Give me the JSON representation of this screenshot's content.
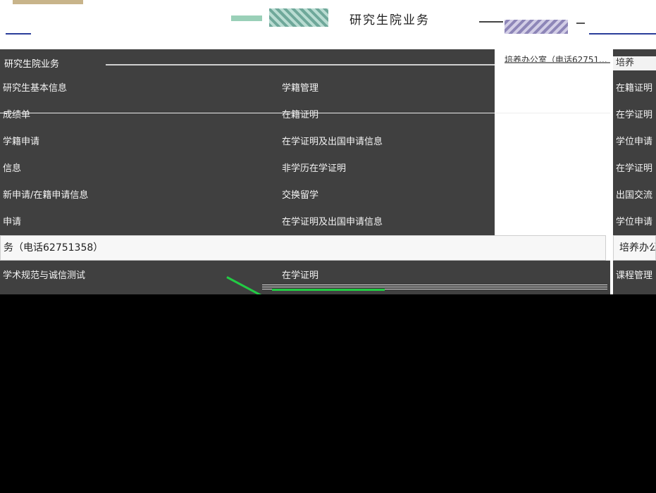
{
  "header": {
    "title": "研究生院业务"
  },
  "left_panel": {
    "heading": "研究生院业务",
    "rows": [
      {
        "col1": "研究生基本信息",
        "col2": "学籍管理"
      },
      {
        "col1": "成绩单",
        "col2": "在籍证明"
      },
      {
        "col1": "学籍申请",
        "col2": "在学证明及出国申请信息"
      },
      {
        "col1": "信息",
        "col2": "非学历在学证明"
      },
      {
        "col1": "新申请/在籍申请信息",
        "col2": "交换留学"
      },
      {
        "col1": "申请",
        "col2": "在学证明及出国申请信息"
      }
    ],
    "band_label": "务（电话62751358）",
    "band_row": {
      "col1": "学术规范与诚信测试",
      "col2": "在学证明"
    }
  },
  "mid_panel": {
    "heading": "培养办公室（电话62751..."
  },
  "right_panel": {
    "heading": "培养",
    "items": [
      "在籍证明",
      "在学证明",
      "学位申请",
      "在学证明",
      "出国交流",
      "学位申请"
    ],
    "band_label": "培养办公",
    "band_item": "课程管理"
  }
}
